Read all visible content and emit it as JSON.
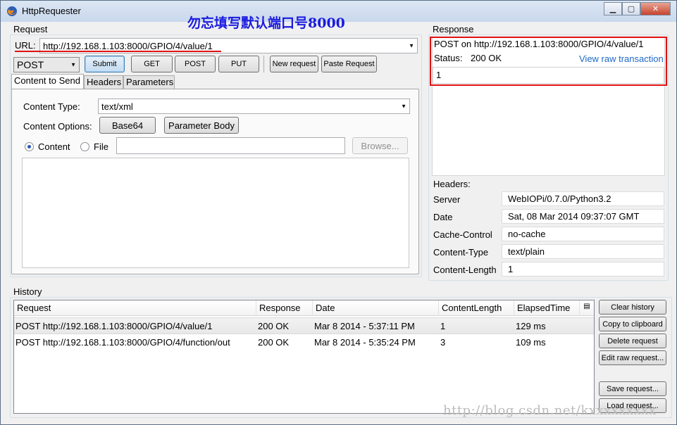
{
  "window": {
    "title": "HttpRequester",
    "overlay_note": "勿忘填写默认端口号8000"
  },
  "request": {
    "group_label": "Request",
    "url_label": "URL:",
    "url_value": "http://192.168.1.103:8000/GPIO/4/value/1",
    "method_value": "POST",
    "buttons": {
      "submit": "Submit",
      "get": "GET",
      "post": "POST",
      "put": "PUT",
      "new_request": "New request",
      "paste_request": "Paste Request"
    },
    "tabs": [
      "Content to Send",
      "Headers",
      "Parameters"
    ],
    "content_type_label": "Content Type:",
    "content_type_value": "text/xml",
    "content_options_label": "Content Options:",
    "base64_button": "Base64",
    "parameter_body_button": "Parameter Body",
    "radio_content": "Content",
    "radio_file": "File",
    "browse_button": "Browse..."
  },
  "response": {
    "group_label": "Response",
    "summary": "POST on http://192.168.1.103:8000/GPIO/4/value/1",
    "status_label": "Status:",
    "status_value": "200 OK",
    "view_raw_link": "View raw transaction",
    "body": "1",
    "headers_label": "Headers:",
    "headers": [
      {
        "name": "Server",
        "value": "WebIOPi/0.7.0/Python3.2"
      },
      {
        "name": "Date",
        "value": "Sat, 08 Mar 2014 09:37:07 GMT"
      },
      {
        "name": "Cache-Control",
        "value": "no-cache"
      },
      {
        "name": "Content-Type",
        "value": "text/plain"
      },
      {
        "name": "Content-Length",
        "value": "1"
      }
    ]
  },
  "history": {
    "group_label": "History",
    "columns": [
      "Request",
      "Response",
      "Date",
      "ContentLength",
      "ElapsedTime"
    ],
    "rows": [
      {
        "request": "POST http://192.168.1.103:8000/GPIO/4/value/1",
        "response": "200 OK",
        "date": "Mar 8 2014 - 5:37:11 PM",
        "length": "1",
        "elapsed": "129 ms"
      },
      {
        "request": "POST http://192.168.1.103:8000/GPIO/4/function/out",
        "response": "200 OK",
        "date": "Mar 8 2014 - 5:35:24 PM",
        "length": "3",
        "elapsed": "109 ms"
      }
    ],
    "buttons": {
      "clear": "Clear history",
      "copy": "Copy to clipboard",
      "delete": "Delete request",
      "edit_raw": "Edit raw request...",
      "save": "Save request...",
      "load": "Load request..."
    }
  },
  "watermark": "http://blog.csdn.net/kxxxxxxxxx",
  "colors": {
    "highlight_box": "#e01212",
    "overlay_note": "#1a1ae0",
    "link": "#1d69c7"
  }
}
